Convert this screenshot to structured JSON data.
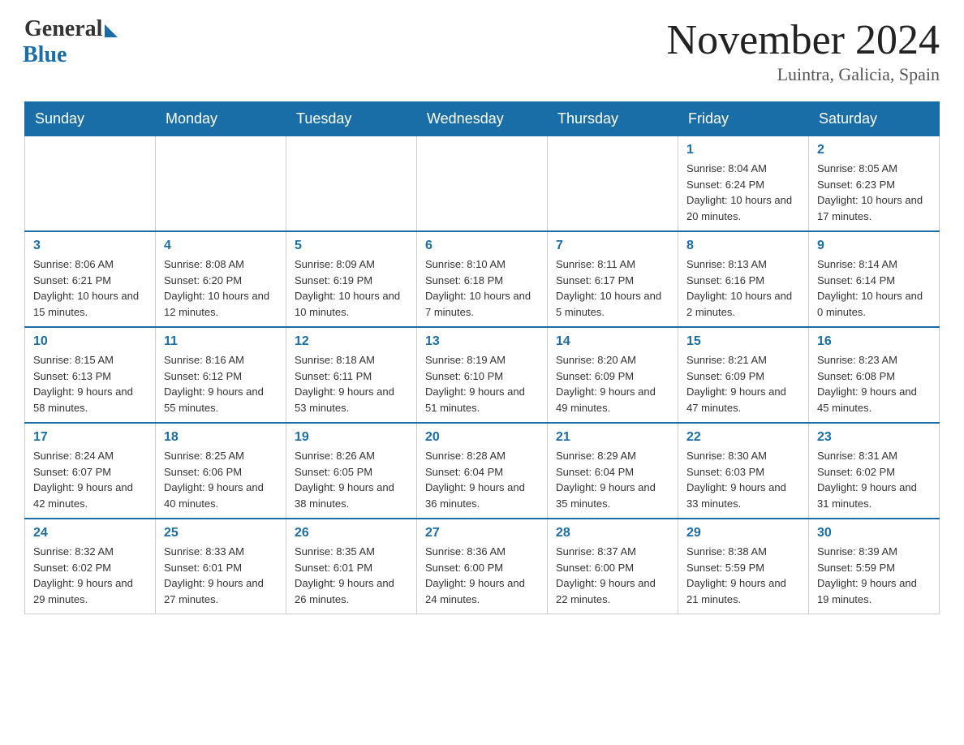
{
  "logo": {
    "general": "General",
    "blue": "Blue"
  },
  "title": "November 2024",
  "location": "Luintra, Galicia, Spain",
  "weekdays": [
    "Sunday",
    "Monday",
    "Tuesday",
    "Wednesday",
    "Thursday",
    "Friday",
    "Saturday"
  ],
  "weeks": [
    [
      {
        "day": "",
        "info": ""
      },
      {
        "day": "",
        "info": ""
      },
      {
        "day": "",
        "info": ""
      },
      {
        "day": "",
        "info": ""
      },
      {
        "day": "",
        "info": ""
      },
      {
        "day": "1",
        "info": "Sunrise: 8:04 AM\nSunset: 6:24 PM\nDaylight: 10 hours and 20 minutes."
      },
      {
        "day": "2",
        "info": "Sunrise: 8:05 AM\nSunset: 6:23 PM\nDaylight: 10 hours and 17 minutes."
      }
    ],
    [
      {
        "day": "3",
        "info": "Sunrise: 8:06 AM\nSunset: 6:21 PM\nDaylight: 10 hours and 15 minutes."
      },
      {
        "day": "4",
        "info": "Sunrise: 8:08 AM\nSunset: 6:20 PM\nDaylight: 10 hours and 12 minutes."
      },
      {
        "day": "5",
        "info": "Sunrise: 8:09 AM\nSunset: 6:19 PM\nDaylight: 10 hours and 10 minutes."
      },
      {
        "day": "6",
        "info": "Sunrise: 8:10 AM\nSunset: 6:18 PM\nDaylight: 10 hours and 7 minutes."
      },
      {
        "day": "7",
        "info": "Sunrise: 8:11 AM\nSunset: 6:17 PM\nDaylight: 10 hours and 5 minutes."
      },
      {
        "day": "8",
        "info": "Sunrise: 8:13 AM\nSunset: 6:16 PM\nDaylight: 10 hours and 2 minutes."
      },
      {
        "day": "9",
        "info": "Sunrise: 8:14 AM\nSunset: 6:14 PM\nDaylight: 10 hours and 0 minutes."
      }
    ],
    [
      {
        "day": "10",
        "info": "Sunrise: 8:15 AM\nSunset: 6:13 PM\nDaylight: 9 hours and 58 minutes."
      },
      {
        "day": "11",
        "info": "Sunrise: 8:16 AM\nSunset: 6:12 PM\nDaylight: 9 hours and 55 minutes."
      },
      {
        "day": "12",
        "info": "Sunrise: 8:18 AM\nSunset: 6:11 PM\nDaylight: 9 hours and 53 minutes."
      },
      {
        "day": "13",
        "info": "Sunrise: 8:19 AM\nSunset: 6:10 PM\nDaylight: 9 hours and 51 minutes."
      },
      {
        "day": "14",
        "info": "Sunrise: 8:20 AM\nSunset: 6:09 PM\nDaylight: 9 hours and 49 minutes."
      },
      {
        "day": "15",
        "info": "Sunrise: 8:21 AM\nSunset: 6:09 PM\nDaylight: 9 hours and 47 minutes."
      },
      {
        "day": "16",
        "info": "Sunrise: 8:23 AM\nSunset: 6:08 PM\nDaylight: 9 hours and 45 minutes."
      }
    ],
    [
      {
        "day": "17",
        "info": "Sunrise: 8:24 AM\nSunset: 6:07 PM\nDaylight: 9 hours and 42 minutes."
      },
      {
        "day": "18",
        "info": "Sunrise: 8:25 AM\nSunset: 6:06 PM\nDaylight: 9 hours and 40 minutes."
      },
      {
        "day": "19",
        "info": "Sunrise: 8:26 AM\nSunset: 6:05 PM\nDaylight: 9 hours and 38 minutes."
      },
      {
        "day": "20",
        "info": "Sunrise: 8:28 AM\nSunset: 6:04 PM\nDaylight: 9 hours and 36 minutes."
      },
      {
        "day": "21",
        "info": "Sunrise: 8:29 AM\nSunset: 6:04 PM\nDaylight: 9 hours and 35 minutes."
      },
      {
        "day": "22",
        "info": "Sunrise: 8:30 AM\nSunset: 6:03 PM\nDaylight: 9 hours and 33 minutes."
      },
      {
        "day": "23",
        "info": "Sunrise: 8:31 AM\nSunset: 6:02 PM\nDaylight: 9 hours and 31 minutes."
      }
    ],
    [
      {
        "day": "24",
        "info": "Sunrise: 8:32 AM\nSunset: 6:02 PM\nDaylight: 9 hours and 29 minutes."
      },
      {
        "day": "25",
        "info": "Sunrise: 8:33 AM\nSunset: 6:01 PM\nDaylight: 9 hours and 27 minutes."
      },
      {
        "day": "26",
        "info": "Sunrise: 8:35 AM\nSunset: 6:01 PM\nDaylight: 9 hours and 26 minutes."
      },
      {
        "day": "27",
        "info": "Sunrise: 8:36 AM\nSunset: 6:00 PM\nDaylight: 9 hours and 24 minutes."
      },
      {
        "day": "28",
        "info": "Sunrise: 8:37 AM\nSunset: 6:00 PM\nDaylight: 9 hours and 22 minutes."
      },
      {
        "day": "29",
        "info": "Sunrise: 8:38 AM\nSunset: 5:59 PM\nDaylight: 9 hours and 21 minutes."
      },
      {
        "day": "30",
        "info": "Sunrise: 8:39 AM\nSunset: 5:59 PM\nDaylight: 9 hours and 19 minutes."
      }
    ]
  ]
}
